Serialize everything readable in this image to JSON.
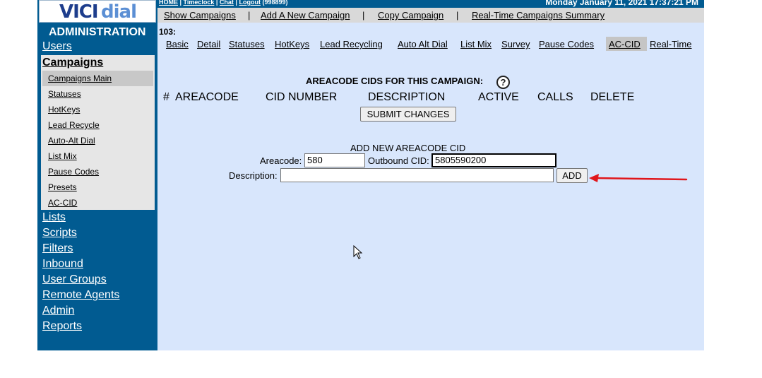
{
  "app": {
    "logo_strong": "VICI",
    "logo_light": "dial"
  },
  "top_strip": {
    "links": [
      "HOME",
      "Timeclock",
      "Chat",
      "Logout"
    ],
    "user_id": "(998899)",
    "datetime": "Monday January 11, 2021 17:37:21 PM"
  },
  "top_menu": {
    "items": [
      "Show Campaigns",
      "Add A New Campaign",
      "Copy Campaign",
      "Real-Time Campaigns Summary"
    ],
    "separator": "|"
  },
  "sidebar": {
    "title": "ADMINISTRATION",
    "items": [
      "Users",
      "Campaigns",
      "Lists",
      "Scripts",
      "Filters",
      "Inbound",
      "User Groups",
      "Remote Agents",
      "Admin",
      "Reports"
    ],
    "campaign_subitems": [
      "Campaigns Main",
      "Statuses",
      "HotKeys",
      "Lead Recycle",
      "Auto-Alt Dial",
      "List Mix",
      "Pause Codes",
      "Presets",
      "AC-CID"
    ]
  },
  "content": {
    "campaign_id": "103:",
    "tabs": [
      "Basic",
      "Detail",
      "Statuses",
      "HotKeys",
      "Lead Recycling",
      "Auto Alt Dial",
      "List Mix",
      "Survey",
      "Pause Codes",
      "AC-CID",
      "Real-Time"
    ],
    "active_tab": "AC-CID",
    "section_title": "AREACODE CIDS FOR THIS CAMPAIGN:",
    "help_icon": "?",
    "columns": [
      "#",
      "AREACODE",
      "CID NUMBER",
      "DESCRIPTION",
      "ACTIVE",
      "CALLS",
      "DELETE"
    ],
    "submit_label": "SUBMIT CHANGES",
    "add_form": {
      "title": "ADD NEW AREACODE CID",
      "areacode_label": "Areacode:",
      "areacode_value": "580",
      "cid_label": "Outbound CID:",
      "cid_value": "5805590200",
      "description_label": "Description:",
      "description_value": "",
      "add_label": "ADD"
    }
  },
  "colors": {
    "sidebar": "#015b91",
    "menu_bar": "#d9d9d9",
    "content": "#d8e6fc",
    "annotation_arrow": "#e0161b"
  }
}
